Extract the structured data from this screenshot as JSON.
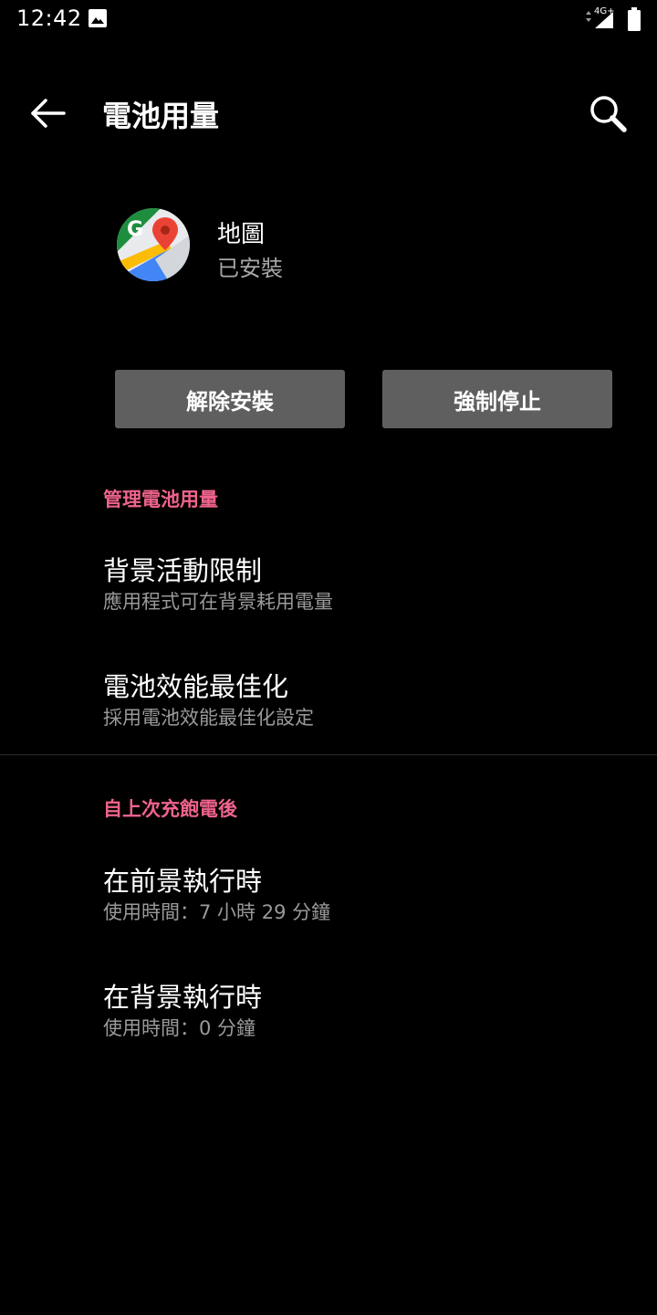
{
  "status_bar": {
    "time": "12:42",
    "network_label": "4G+",
    "icons": [
      "image-icon",
      "signal-icon",
      "battery-icon"
    ]
  },
  "toolbar": {
    "title": "電池用量",
    "back_icon": "back-arrow-icon",
    "search_icon": "search-icon"
  },
  "app": {
    "name": "地圖",
    "status": "已安裝",
    "icon": "google-maps-icon"
  },
  "buttons": {
    "uninstall": "解除安裝",
    "force_stop": "強制停止"
  },
  "sections": [
    {
      "header": "管理電池用量",
      "items": [
        {
          "title": "背景活動限制",
          "summary": "應用程式可在背景耗用電量"
        },
        {
          "title": "電池效能最佳化",
          "summary": "採用電池效能最佳化設定"
        }
      ]
    },
    {
      "header": "自上次充飽電後",
      "items": [
        {
          "title": "在前景執行時",
          "summary": "使用時間：7 小時 29 分鐘"
        },
        {
          "title": "在背景執行時",
          "summary": "使用時間：0 分鐘"
        }
      ]
    }
  ],
  "colors": {
    "background": "#000000",
    "accent": "#f0648c",
    "button_bg": "#5f5f5f",
    "secondary_text": "#9a9a9a"
  }
}
